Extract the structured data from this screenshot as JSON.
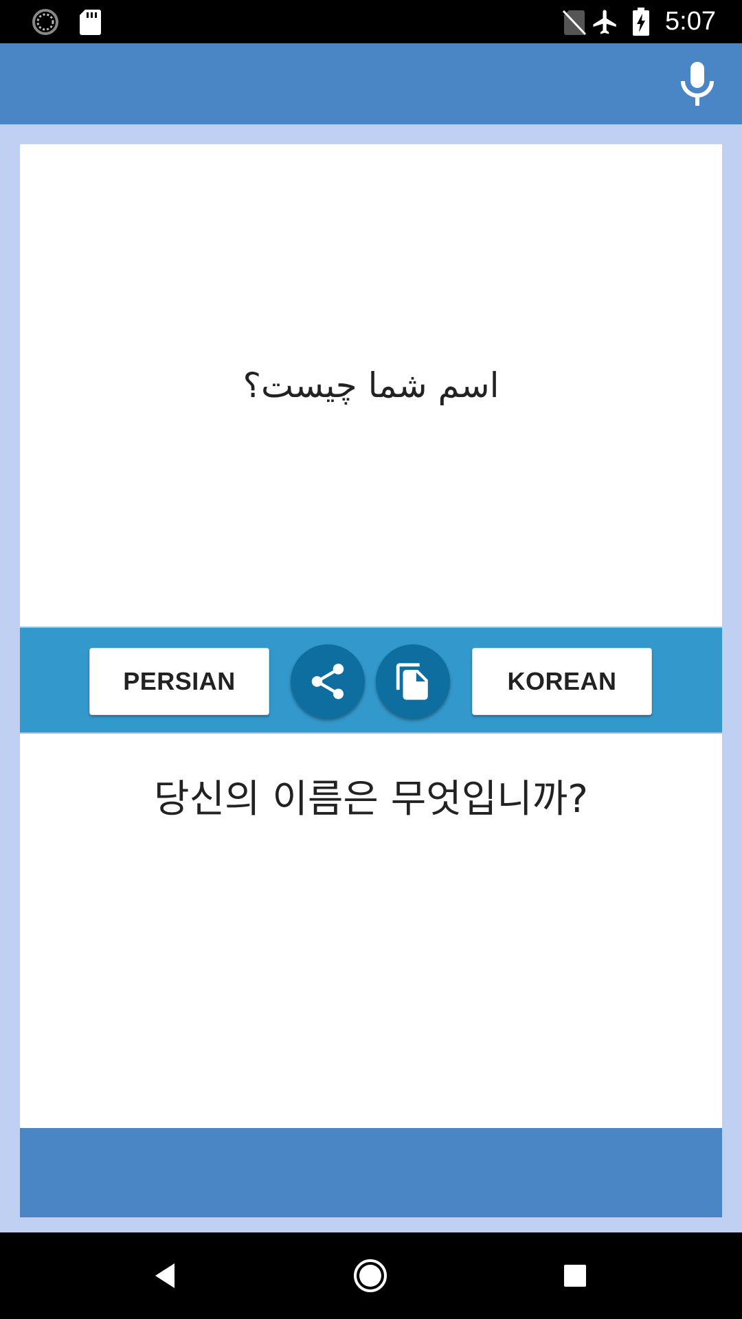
{
  "status_bar": {
    "time": "5:07",
    "icons": [
      "loading-icon",
      "sd-card-icon",
      "no-sim-icon",
      "airplane-mode-icon",
      "battery-charging-icon"
    ]
  },
  "app_bar": {
    "icons": [
      "microphone-icon"
    ],
    "accent_color": "#4A86C5"
  },
  "source": {
    "text": "اسم شما چیست؟"
  },
  "controls": {
    "source_language": "PERSIAN",
    "target_language": "KOREAN",
    "icons": [
      "share-icon",
      "copy-icon"
    ],
    "bar_color": "#3399CC",
    "button_color": "#0E6E9F"
  },
  "target": {
    "text": "당신의 이름은 무엇입니까?"
  },
  "nav_bar": {
    "icons": [
      "back-icon",
      "home-icon",
      "recents-icon"
    ]
  }
}
